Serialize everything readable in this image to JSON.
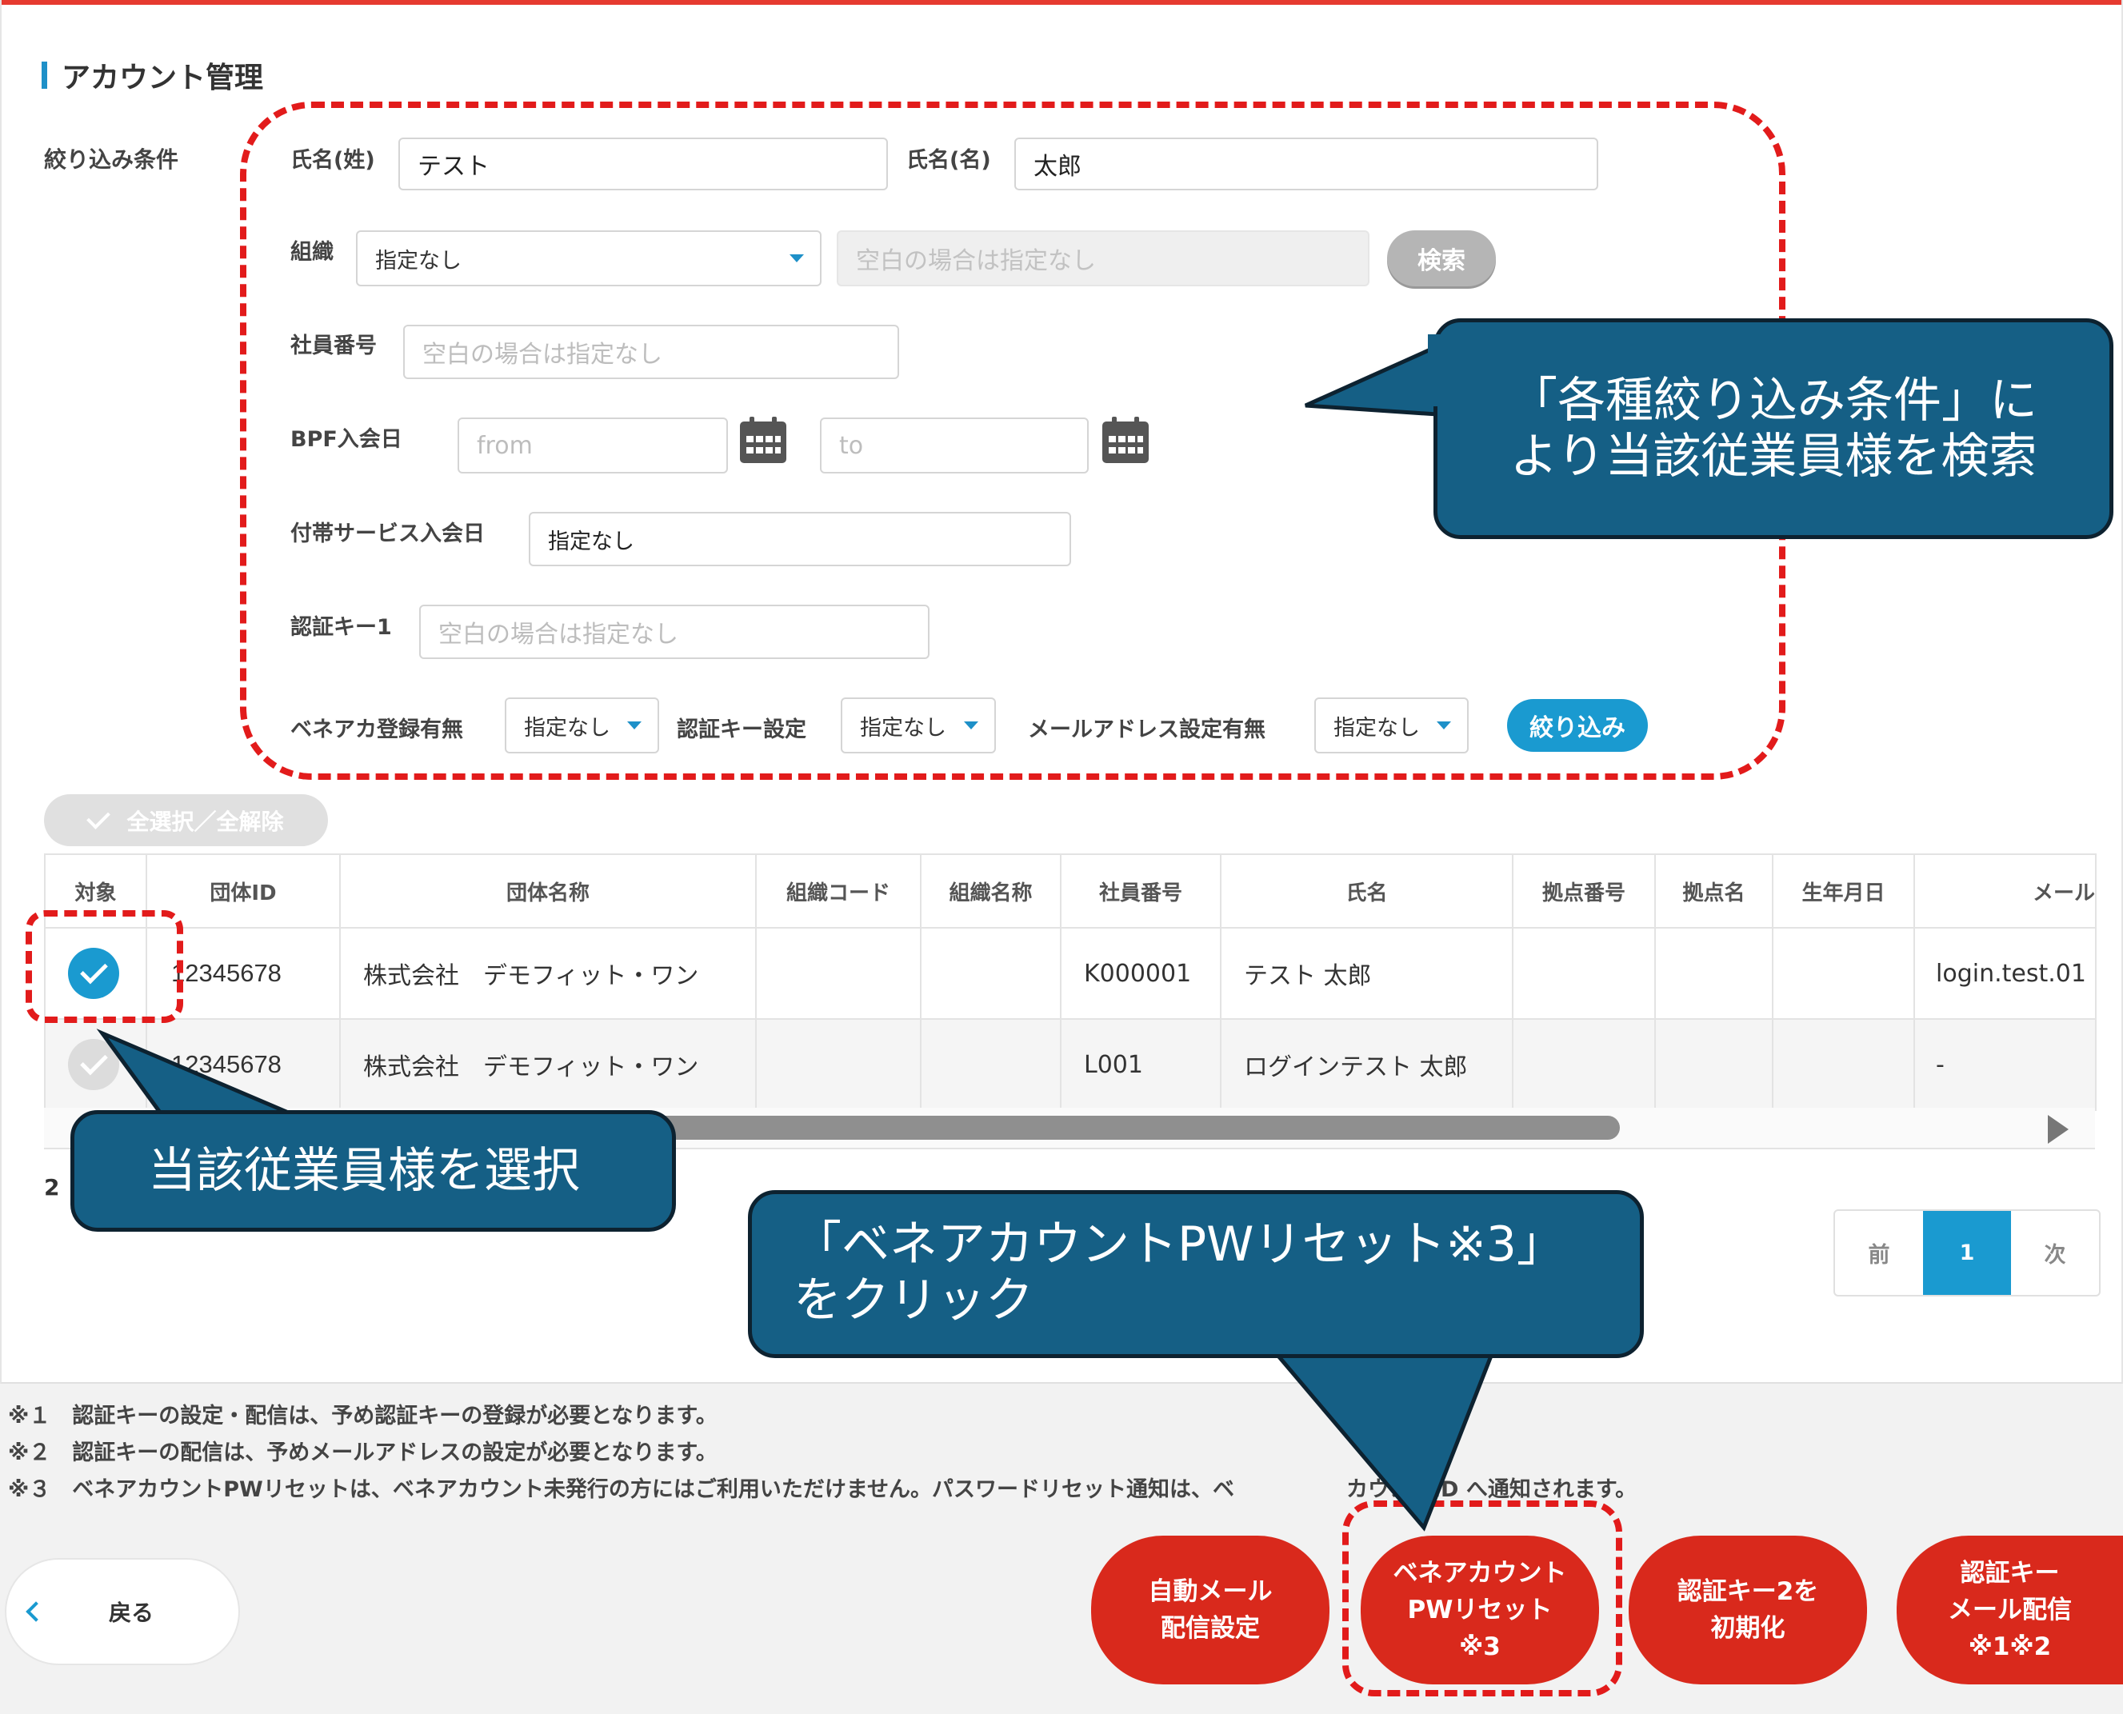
{
  "page": {
    "title": "アカウント管理"
  },
  "filter": {
    "heading": "絞り込み条件",
    "last_name_label": "氏名(姓)",
    "last_name_value": "テスト",
    "first_name_label": "氏名(名)",
    "first_name_value": "太郎",
    "org_label": "組織",
    "org_selected": "指定なし",
    "org_placeholder": "空白の場合は指定なし",
    "search_label": "検索",
    "employee_no_label": "社員番号",
    "employee_no_placeholder": "空白の場合は指定なし",
    "bpf_label": "BPF入会日",
    "bpf_from_placeholder": "from",
    "bpf_to_placeholder": "to",
    "service_label": "付帯サービス入会日",
    "service_selected": "指定なし",
    "authkey_label": "認証キー1",
    "authkey_placeholder": "空白の場合は指定なし",
    "bene_reg_label": "ベネアカ登録有無",
    "bene_reg_selected": "指定なし",
    "authkey_set_label": "認証キー設定",
    "authkey_set_selected": "指定なし",
    "mail_set_label": "メールアドレス設定有無",
    "mail_set_selected": "指定なし",
    "apply_label": "絞り込み"
  },
  "select_all_label": "全選択／全解除",
  "table": {
    "headers": [
      "対象",
      "団体ID",
      "団体名称",
      "組織コード",
      "組織名称",
      "社員番号",
      "氏名",
      "拠点番号",
      "拠点名",
      "生年月日",
      "メール"
    ],
    "rows": [
      {
        "checked": true,
        "group_id": "12345678",
        "group_name": "株式会社　デモフィット・ワン",
        "org_code": "",
        "org_name": "",
        "emp_no": "K000001",
        "name": "テスト 太郎",
        "site_no": "",
        "site_name": "",
        "birth": "",
        "mail": "login.test.01"
      },
      {
        "checked": false,
        "group_id": "12345678",
        "group_name": "株式会社　デモフィット・ワン",
        "org_code": "",
        "org_name": "",
        "emp_no": "L001",
        "name": "ログインテスト 太郎",
        "site_no": "",
        "site_name": "",
        "birth": "",
        "mail": "-"
      }
    ]
  },
  "count_text": "2",
  "pager": {
    "prev": "前",
    "current": "1",
    "next": "次"
  },
  "notes": [
    "※１　認証キーの設定・配信は、予め認証キーの登録が必要となります。",
    "※２　認証キーの配信は、予めメールアドレスの設定が必要となります。",
    "※３　ベネアカウントPWリセットは、ベネアカウント未発行の方にはご利用いただけません。パスワードリセット通知は、ベ",
    "カウントID へ通知されます。"
  ],
  "buttons": {
    "back": "戻る",
    "auto_mail": [
      "自動メール",
      "配信設定"
    ],
    "pw_reset": [
      "ベネアカウント",
      "PWリセット",
      "※3"
    ],
    "init_key2": [
      "認証キー2を",
      "初期化"
    ],
    "key_mail": [
      "認証キー",
      "メール配信",
      "※1※2"
    ]
  },
  "callouts": {
    "search": [
      "「各種絞り込み条件」に",
      "より当該従業員様を検索"
    ],
    "select": "当該従業員様を選択",
    "click": [
      "「ベネアカウントPWリセット※3」",
      "をクリック"
    ]
  },
  "colors": {
    "accent_blue": "#1a9ad0",
    "action_red": "#d9291c",
    "callout_bg": "#155f85",
    "dash_red": "#e21b1b"
  },
  "icons": {
    "calendar": "calendar-icon",
    "caret": "caret-down-icon",
    "check": "check-icon",
    "back": "chevron-left-icon"
  }
}
